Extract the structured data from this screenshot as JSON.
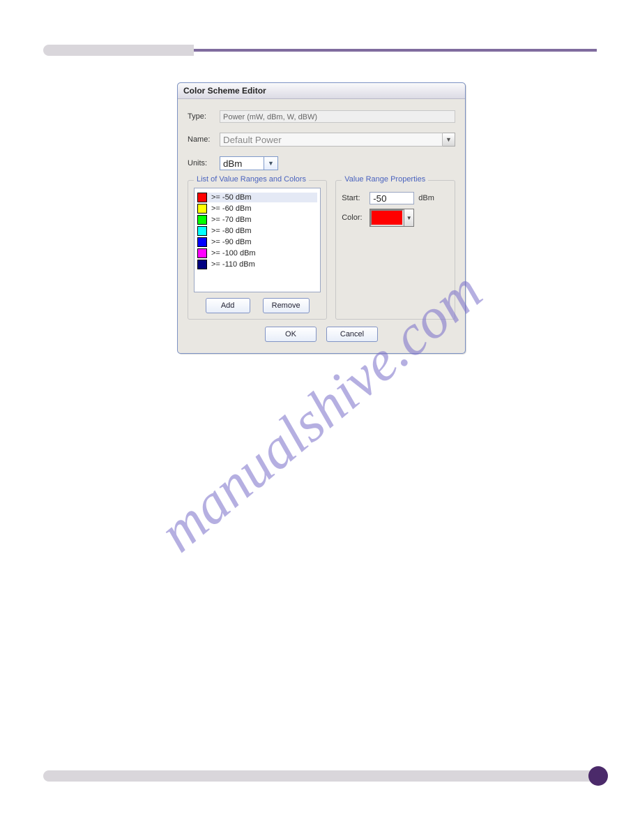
{
  "watermark": "manualshive.com",
  "dialog": {
    "title": "Color Scheme Editor",
    "type_label": "Type:",
    "type_value": "Power (mW, dBm, W, dBW)",
    "name_label": "Name:",
    "name_value": "Default Power",
    "units_label": "Units:",
    "units_value": "dBm",
    "left_legend": "List of Value Ranges and Colors",
    "right_legend": "Value Range Properties",
    "ranges": [
      {
        "color": "#ff0000",
        "label": ">= -50 dBm"
      },
      {
        "color": "#ffff00",
        "label": ">= -60 dBm"
      },
      {
        "color": "#00ff00",
        "label": ">= -70 dBm"
      },
      {
        "color": "#00ffff",
        "label": ">= -80 dBm"
      },
      {
        "color": "#0000ff",
        "label": ">= -90 dBm"
      },
      {
        "color": "#ff00ff",
        "label": ">= -100 dBm"
      },
      {
        "color": "#000080",
        "label": ">= -110 dBm"
      }
    ],
    "add_label": "Add",
    "remove_label": "Remove",
    "start_label": "Start:",
    "start_value": "-50",
    "start_unit": "dBm",
    "color_label": "Color:",
    "selected_color": "#ff0000",
    "ok_label": "OK",
    "cancel_label": "Cancel"
  }
}
